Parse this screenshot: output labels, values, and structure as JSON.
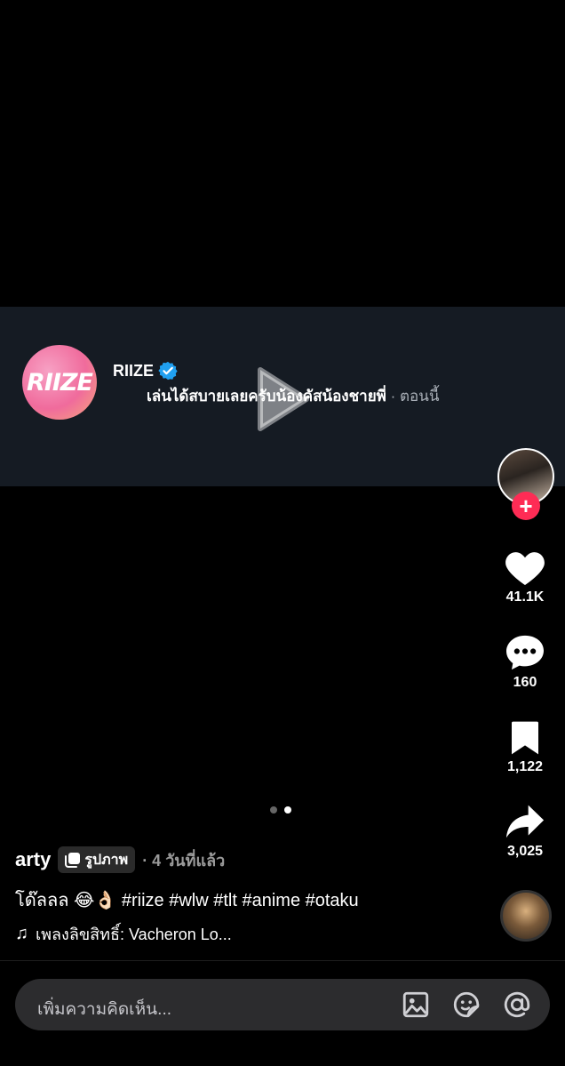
{
  "brand_post": {
    "avatar_text": "RIIZE",
    "name": "RIIZE",
    "comment": "เล่นได้สบายเลยครับน้องคัสน้องชายพี่",
    "time": "· ตอนนี้"
  },
  "actions": {
    "likes": "41.1K",
    "comments": "160",
    "saves": "1,122",
    "shares": "3,025"
  },
  "post": {
    "username": "arty",
    "badge": "รูปภาพ",
    "time_ago": "· 4 วันที่แล้ว",
    "caption": "โด๊ลลล 😂👌🏻 #riize #wlw #tlt #anime #otaku",
    "music": "เพลงลิขสิทธิ์: Vacheron Lo..."
  },
  "carousel": {
    "count": 2,
    "active": 1
  },
  "comment_bar": {
    "placeholder": "เพิ่มความคิดเห็น..."
  },
  "icons": [
    "play-icon",
    "verified-icon",
    "heart-icon",
    "comment-icon",
    "bookmark-icon",
    "share-icon",
    "image-icon",
    "sticker-icon",
    "mention-icon",
    "music-note-icon",
    "photo-icon"
  ],
  "colors": {
    "accent": "#fe2c55",
    "verified": "#20a0f0",
    "band": "#151b23",
    "input": "#2c2c2e"
  }
}
